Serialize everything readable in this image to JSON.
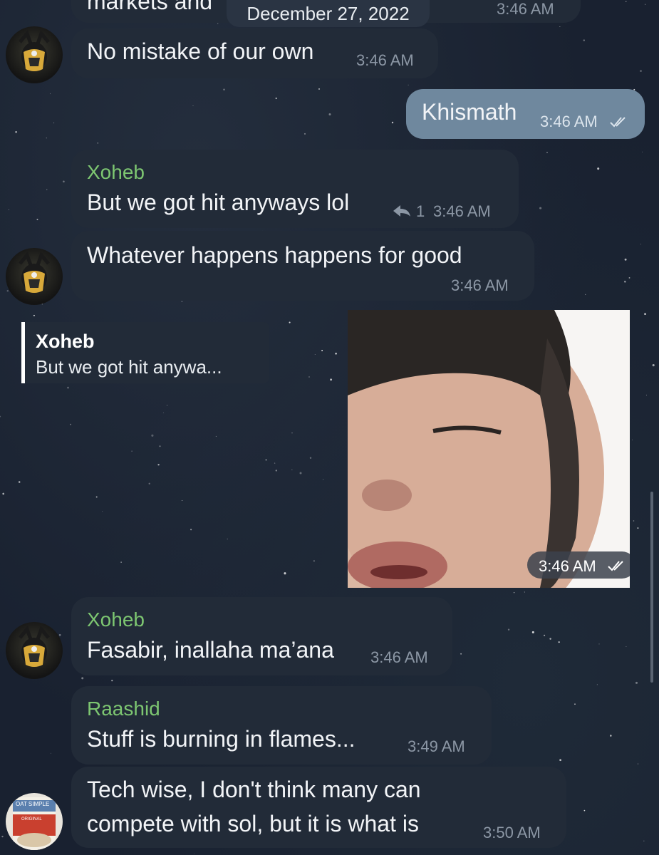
{
  "date_label": "December 27, 2022",
  "messages": {
    "top_partial": {
      "text": "markets and",
      "time": "3:46 AM"
    },
    "m1": {
      "text": "No mistake of our own",
      "time": "3:46 AM"
    },
    "m2": {
      "text": "Khismath",
      "time": "3:46 AM"
    },
    "m3": {
      "sender": "Xoheb",
      "text": "But we got hit anyways lol",
      "reply_count": "1",
      "time": "3:46 AM"
    },
    "m4": {
      "text": "Whatever happens happens for good",
      "time": "3:46 AM"
    },
    "m5": {
      "reply_sender": "Xoheb",
      "reply_text": "But we got hit anywa...",
      "time": "3:46 AM"
    },
    "m6": {
      "sender": "Xoheb",
      "text": "Fasabir, inallaha ma’ana",
      "time": "3:46 AM"
    },
    "m7": {
      "sender": "Raashid",
      "text": "Stuff is burning in flames...",
      "time": "3:49 AM"
    },
    "m8": {
      "text_line1": "Tech wise, I don't think many can",
      "text_line2": "compete with sol, but it is what is",
      "time": "3:50 AM"
    }
  },
  "avatar2": {
    "brand": "OAT SIMPLE",
    "label": "ORIGINAL"
  },
  "colors": {
    "sender": "#7dc671",
    "incoming": "#222b38",
    "outgoing": "#6f889e"
  }
}
